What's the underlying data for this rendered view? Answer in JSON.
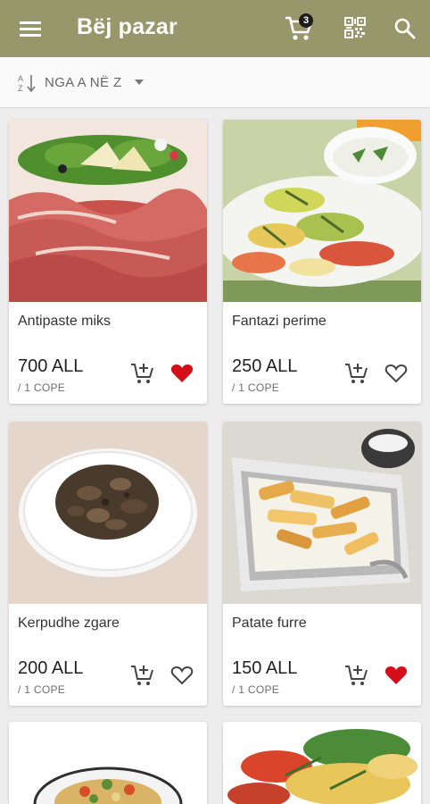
{
  "appbar": {
    "title": "Bëj pazar",
    "cart_count": "3"
  },
  "sort": {
    "label": "NGA A NË Z"
  },
  "colors": {
    "appbar": "#97976b",
    "favorite_active": "#d40f1a"
  },
  "products": [
    {
      "name": "Antipaste miks",
      "price": "700 ALL",
      "unit": "/ 1 COPE",
      "favorite": true
    },
    {
      "name": "Fantazi perime",
      "price": "250 ALL",
      "unit": "/ 1 COPE",
      "favorite": false
    },
    {
      "name": "Kerpudhe zgare",
      "price": "200 ALL",
      "unit": "/ 1 COPE",
      "favorite": false
    },
    {
      "name": "Patate furre",
      "price": "150 ALL",
      "unit": "/ 1 COPE",
      "favorite": true
    }
  ]
}
